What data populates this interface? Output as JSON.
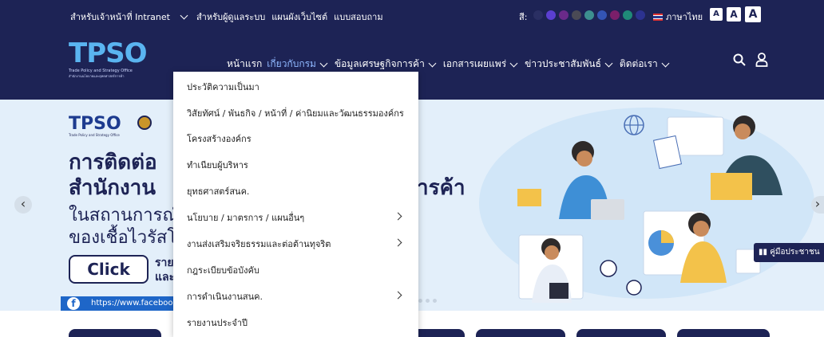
{
  "topbar": {
    "intranet": "สำหรับเจ้าหน้าที่ Intranet",
    "admin": "สำหรับผู้ดูแลระบบ",
    "sitemap": "แผนผังเว็บไซต์",
    "survey": "แบบสอบถาม",
    "color_label": "สี:",
    "language": "ภาษาไทย",
    "font_sizes": [
      "A",
      "A",
      "A"
    ],
    "theme_colors": [
      "#2a2f63",
      "#5b3fd1",
      "#6a2a8a",
      "#4a4a55",
      "#3d8f8f",
      "#3355b5",
      "#7a1f6a",
      "#1f8a78",
      "#2c3290"
    ]
  },
  "brand": {
    "logo_text": "TPSO",
    "logo_sub_en": "Trade Policy and Strategy Office",
    "logo_sub_th": "สำนักงานนโยบายและยุทธศาสตร์การค้า"
  },
  "nav": {
    "items": [
      {
        "label": "หน้าแรก",
        "has_caret": false
      },
      {
        "label": "เกี่ยวกับกรม",
        "has_caret": true
      },
      {
        "label": "ข้อมูลเศรษฐกิจการค้า",
        "has_caret": true
      },
      {
        "label": "เอกสารเผยแพร่",
        "has_caret": true
      },
      {
        "label": "ข่าวประชาสัมพันธ์",
        "has_caret": true
      },
      {
        "label": "ติดต่อเรา",
        "has_caret": true
      }
    ],
    "icons": [
      "search-icon",
      "user-icon"
    ]
  },
  "dropdown": {
    "items": [
      {
        "label": "ประวัติความเป็นมา",
        "submenu": false
      },
      {
        "label": "วิสัยทัศน์ / พันธกิจ / หน้าที่ / ค่านิยมและวัฒนธรรมองค์กร",
        "submenu": false
      },
      {
        "label": "โครงสร้างองค์กร",
        "submenu": false
      },
      {
        "label": "ทำเนียบผู้บริหาร",
        "submenu": false
      },
      {
        "label": "ยุทธศาสตร์สนค.",
        "submenu": false
      },
      {
        "label": "นโยบาย / มาตรการ / แผนอื่นๆ",
        "submenu": true
      },
      {
        "label": "งานส่งเสริมจริยธรรมและต่อต้านทุจริต",
        "submenu": true
      },
      {
        "label": "กฎระเบียบข้อบังคับ",
        "submenu": false
      },
      {
        "label": "การดำเนินงานสนค.",
        "submenu": true
      },
      {
        "label": "รายงานประจำปี",
        "submenu": false
      }
    ]
  },
  "hero": {
    "logo_text": "TPSO",
    "logo_sub": "Trade Policy and Strategy Office",
    "line1": "การติดต่อ",
    "line2": "สำนักงาน",
    "line2_tail": "ารค้า",
    "line3": "ในสถานการณ์",
    "line4": "ของเชื้อไวรัสโ",
    "click_label": "Click",
    "click_side1": "ราย",
    "click_side2": "และ",
    "facebook_url": "https://www.facebook.c",
    "manual_label": "คู่มือประชาชน",
    "prev_arrow": "‹",
    "next_arrow": "›"
  }
}
